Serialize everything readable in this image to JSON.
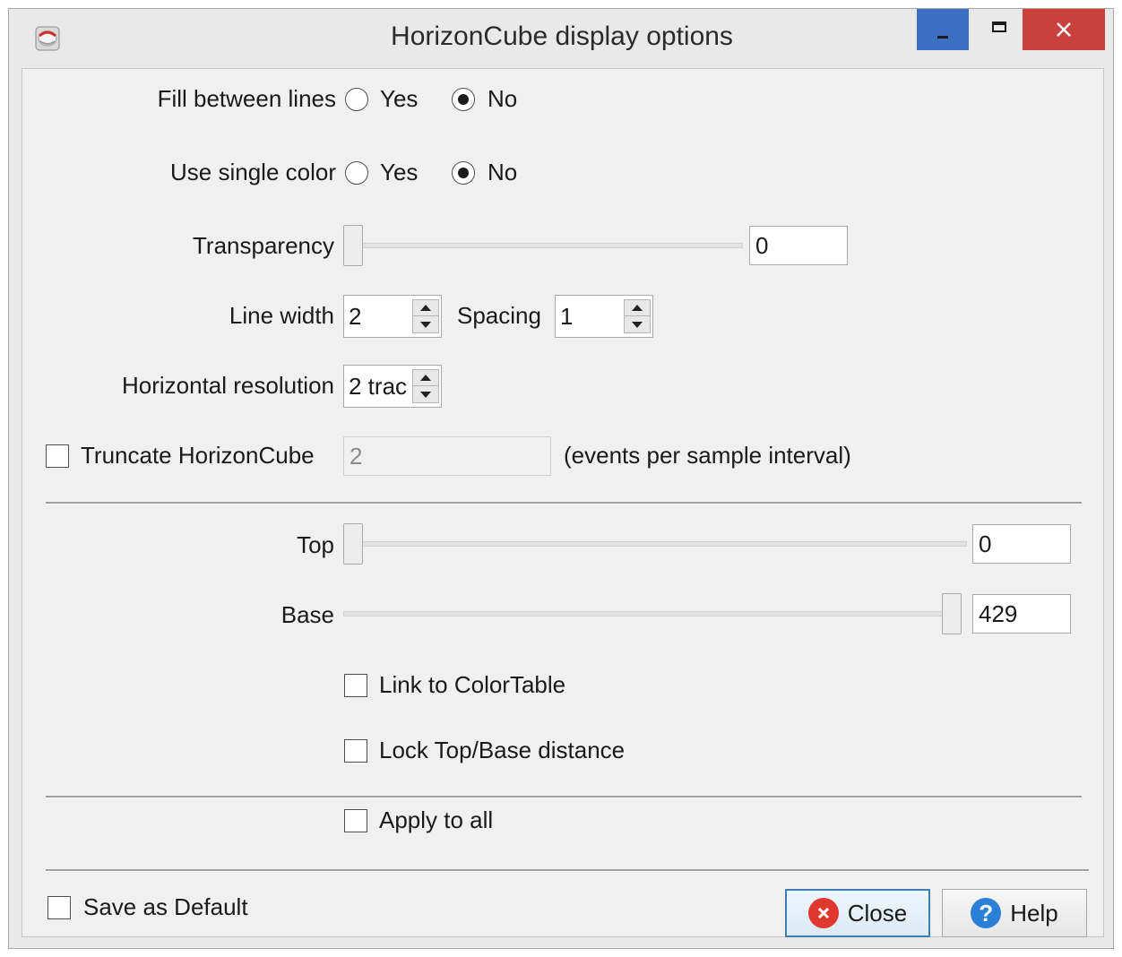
{
  "window": {
    "title": "HorizonCube display options"
  },
  "fill_between_lines": {
    "label": "Fill between lines",
    "yes_label": "Yes",
    "no_label": "No",
    "selected": "No"
  },
  "use_single_color": {
    "label": "Use single color",
    "yes_label": "Yes",
    "no_label": "No",
    "selected": "No"
  },
  "transparency": {
    "label": "Transparency",
    "value": "0",
    "slider_level": 0
  },
  "line_width": {
    "label": "Line width",
    "value": "2"
  },
  "spacing": {
    "label": "Spacing",
    "value": "1"
  },
  "horizontal_resolution": {
    "label": "Horizontal resolution",
    "value": "2 trac"
  },
  "truncate": {
    "label": "Truncate HorizonCube",
    "value": "2",
    "suffix": "(events per sample interval)",
    "checked": false
  },
  "top": {
    "label": "Top",
    "value": "0",
    "slider_level": 0
  },
  "base": {
    "label": "Base",
    "value": "429",
    "slider_level": 1
  },
  "link_to_colortable": {
    "label": "Link to ColorTable",
    "checked": false
  },
  "lock_top_base": {
    "label": "Lock Top/Base distance",
    "checked": false
  },
  "apply_to_all": {
    "label": "Apply to all",
    "checked": false
  },
  "save_as_default": {
    "label": "Save as Default",
    "checked": false
  },
  "buttons": {
    "close_label": "Close",
    "help_label": "Help"
  },
  "colors": {
    "close_icon": "#e0382e",
    "help_icon": "#2a7fd6",
    "minimize_bg": "#3d6fc2",
    "window_close_bg": "#c9403c"
  }
}
